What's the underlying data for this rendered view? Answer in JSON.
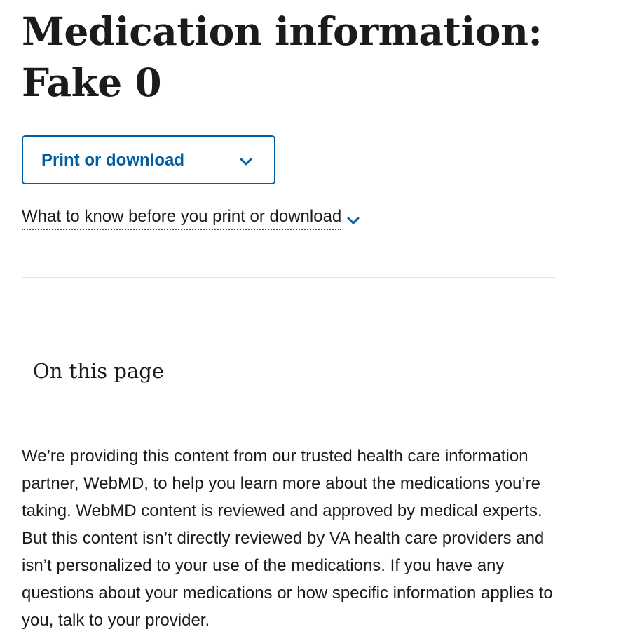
{
  "page_title": "Medication information: Fake 0",
  "print_button": {
    "label": "Print or download",
    "icon": "chevron-down-icon"
  },
  "before_print_link": {
    "label": "What to know before you print or download",
    "icon": "chevron-down-icon"
  },
  "on_this_page": {
    "heading": "On this page"
  },
  "intro_text": "We’re providing this content from our trusted health care information partner, WebMD, to help you learn more about the medications you’re taking. WebMD content is reviewed and approved by medical experts. But this content isn’t directly reviewed by VA health care providers and isn’t personalized to your use of the medications. If you have any questions about your medications or how specific information applies to you, talk to your provider.",
  "colors": {
    "primary": "#005ea2",
    "text": "#1b1b1b",
    "divider": "#dfe1e2",
    "background": "#ffffff"
  }
}
